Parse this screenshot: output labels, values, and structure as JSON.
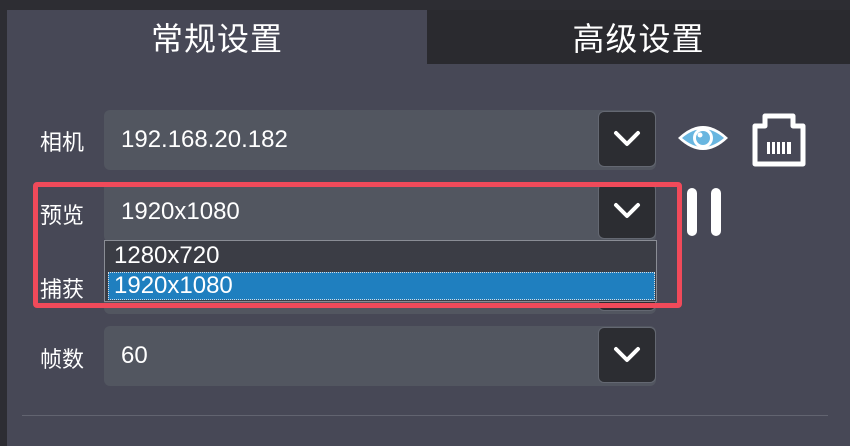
{
  "tabs": {
    "general": "常规设置",
    "advanced": "高级设置"
  },
  "camera": {
    "label": "相机",
    "value": "192.168.20.182"
  },
  "preview": {
    "label": "预览",
    "value": "1920x1080",
    "options": [
      "1280x720",
      "1920x1080"
    ],
    "selected_index": 1
  },
  "capture": {
    "label": "捕获"
  },
  "fps": {
    "label": "帧数",
    "value": "60"
  },
  "icons": {
    "dropdown_arrow": "chevron-down-icon",
    "preview_toggle": "eye-icon",
    "network": "ethernet-port-icon",
    "pause": "pause-icon"
  },
  "colors": {
    "panel": "#474856",
    "combo": "#525660",
    "eye": "#69b6e0",
    "selection": "#1f7fbf",
    "highlight": "#f04a5a"
  }
}
